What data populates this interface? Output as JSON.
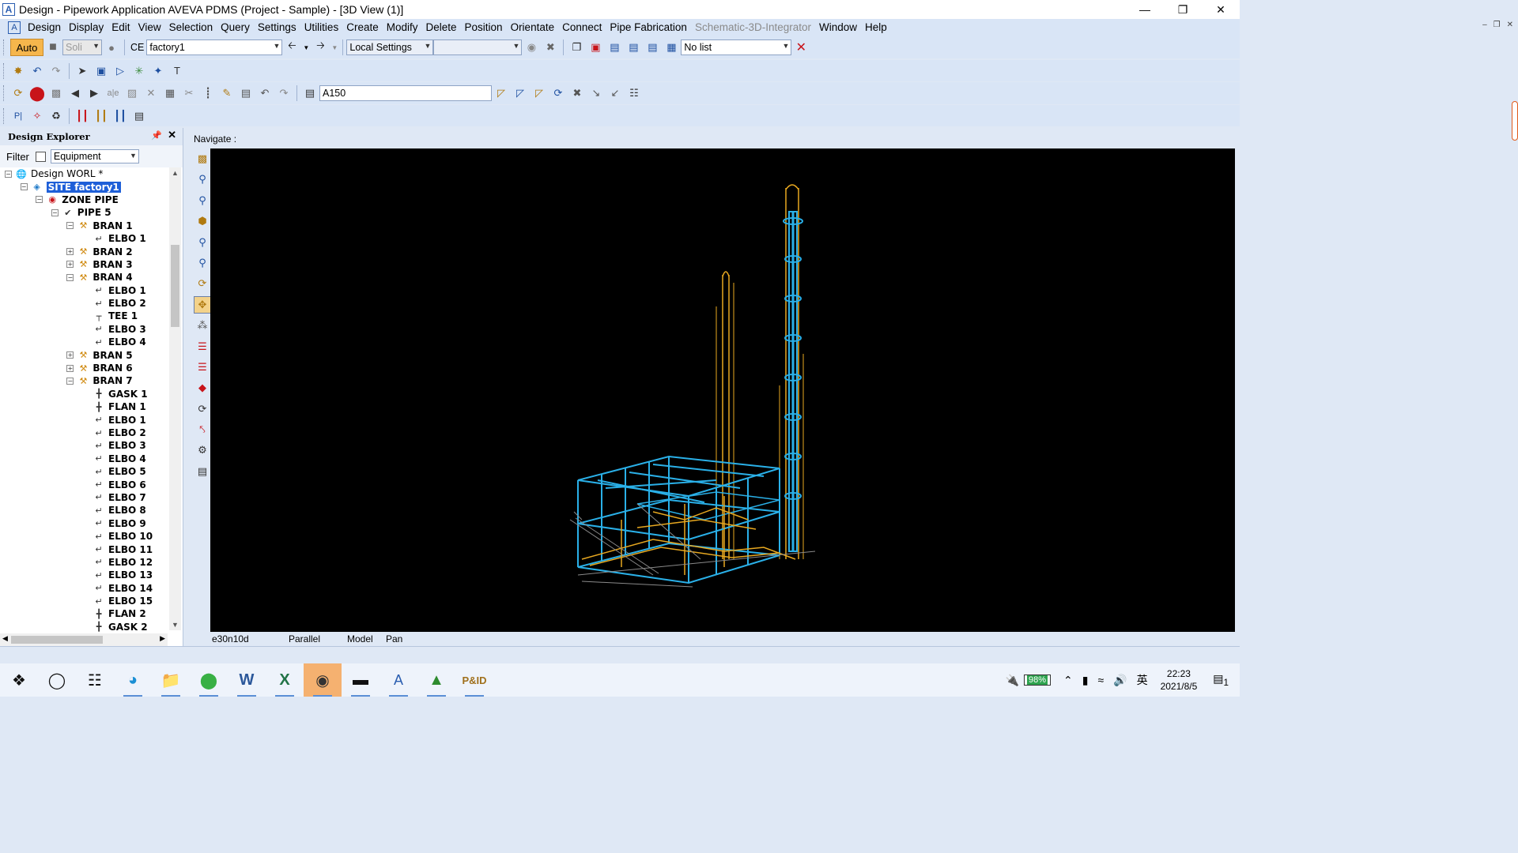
{
  "window": {
    "title": "Design - Pipework Application  AVEVA PDMS (Project - Sample) - [3D View (1)]",
    "app_icon": "A",
    "controls": [
      "minimize-icon",
      "restore-icon",
      "close-icon"
    ]
  },
  "menu": {
    "items": [
      "Design",
      "Display",
      "Edit",
      "View",
      "Selection",
      "Query",
      "Settings",
      "Utilities",
      "Create",
      "Modify",
      "Delete",
      "Position",
      "Orientate",
      "Connect",
      "Pipe Fabrication",
      "Schematic-3D-Integrator",
      "Window",
      "Help"
    ],
    "disabled": [
      "Schematic-3D-Integrator"
    ]
  },
  "toolbar1": {
    "auto_label": "Auto",
    "solid_value": "Soli",
    "ce_label": "CE",
    "ce_value": "factory1",
    "local_settings": "Local Settings",
    "blank_combo": "",
    "list_value": "No list"
  },
  "toolbar3": {
    "spec_value": "A150"
  },
  "explorer": {
    "title": "Design Explorer",
    "filter_label": "Filter",
    "filter_value": "Equipment",
    "tree": [
      {
        "label": "Design WORL *",
        "depth": 0,
        "exp": "-",
        "icon": "globe",
        "bold": false
      },
      {
        "label": "SITE factory1",
        "depth": 1,
        "exp": "-",
        "icon": "site",
        "bold": true,
        "selected": true
      },
      {
        "label": "ZONE PIPE",
        "depth": 2,
        "exp": "-",
        "icon": "zone",
        "bold": true
      },
      {
        "label": "PIPE 5",
        "depth": 3,
        "exp": "-",
        "icon": "pipe",
        "bold": true
      },
      {
        "label": "BRAN 1",
        "depth": 4,
        "exp": "-",
        "icon": "bran",
        "bold": true
      },
      {
        "label": "ELBO 1",
        "depth": 5,
        "exp": "",
        "icon": "elbo",
        "bold": true
      },
      {
        "label": "BRAN 2",
        "depth": 4,
        "exp": "+",
        "icon": "bran",
        "bold": true
      },
      {
        "label": "BRAN 3",
        "depth": 4,
        "exp": "+",
        "icon": "bran",
        "bold": true
      },
      {
        "label": "BRAN 4",
        "depth": 4,
        "exp": "-",
        "icon": "bran",
        "bold": true
      },
      {
        "label": "ELBO 1",
        "depth": 5,
        "exp": "",
        "icon": "elbo",
        "bold": true
      },
      {
        "label": "ELBO 2",
        "depth": 5,
        "exp": "",
        "icon": "elbo",
        "bold": true
      },
      {
        "label": "TEE 1",
        "depth": 5,
        "exp": "",
        "icon": "tee",
        "bold": true
      },
      {
        "label": "ELBO 3",
        "depth": 5,
        "exp": "",
        "icon": "elbo",
        "bold": true
      },
      {
        "label": "ELBO 4",
        "depth": 5,
        "exp": "",
        "icon": "elbo",
        "bold": true
      },
      {
        "label": "BRAN 5",
        "depth": 4,
        "exp": "+",
        "icon": "bran",
        "bold": true
      },
      {
        "label": "BRAN 6",
        "depth": 4,
        "exp": "+",
        "icon": "bran",
        "bold": true
      },
      {
        "label": "BRAN 7",
        "depth": 4,
        "exp": "-",
        "icon": "bran",
        "bold": true
      },
      {
        "label": "GASK 1",
        "depth": 5,
        "exp": "",
        "icon": "gask",
        "bold": true
      },
      {
        "label": "FLAN 1",
        "depth": 5,
        "exp": "",
        "icon": "flan",
        "bold": true
      },
      {
        "label": "ELBO 1",
        "depth": 5,
        "exp": "",
        "icon": "elbo",
        "bold": true
      },
      {
        "label": "ELBO 2",
        "depth": 5,
        "exp": "",
        "icon": "elbo",
        "bold": true
      },
      {
        "label": "ELBO 3",
        "depth": 5,
        "exp": "",
        "icon": "elbo",
        "bold": true
      },
      {
        "label": "ELBO 4",
        "depth": 5,
        "exp": "",
        "icon": "elbo",
        "bold": true
      },
      {
        "label": "ELBO 5",
        "depth": 5,
        "exp": "",
        "icon": "elbo",
        "bold": true
      },
      {
        "label": "ELBO 6",
        "depth": 5,
        "exp": "",
        "icon": "elbo",
        "bold": true
      },
      {
        "label": "ELBO 7",
        "depth": 5,
        "exp": "",
        "icon": "elbo",
        "bold": true
      },
      {
        "label": "ELBO 8",
        "depth": 5,
        "exp": "",
        "icon": "elbo",
        "bold": true
      },
      {
        "label": "ELBO 9",
        "depth": 5,
        "exp": "",
        "icon": "elbo",
        "bold": true
      },
      {
        "label": "ELBO 10",
        "depth": 5,
        "exp": "",
        "icon": "elbo",
        "bold": true
      },
      {
        "label": "ELBO 11",
        "depth": 5,
        "exp": "",
        "icon": "elbo",
        "bold": true
      },
      {
        "label": "ELBO 12",
        "depth": 5,
        "exp": "",
        "icon": "elbo",
        "bold": true
      },
      {
        "label": "ELBO 13",
        "depth": 5,
        "exp": "",
        "icon": "elbo",
        "bold": true
      },
      {
        "label": "ELBO 14",
        "depth": 5,
        "exp": "",
        "icon": "elbo",
        "bold": true
      },
      {
        "label": "ELBO 15",
        "depth": 5,
        "exp": "",
        "icon": "elbo",
        "bold": true
      },
      {
        "label": "FLAN 2",
        "depth": 5,
        "exp": "",
        "icon": "flan",
        "bold": true
      },
      {
        "label": "GASK 2",
        "depth": 5,
        "exp": "",
        "icon": "gask",
        "bold": true
      }
    ]
  },
  "view3d": {
    "navigate_label": "Navigate :",
    "status_direction": "e30n10d",
    "status_projection": "Parallel",
    "status_mode": "Model",
    "status_action": "Pan",
    "colors": {
      "structure": "#2ab0e8",
      "pipe": "#e8a820",
      "background": "#000000"
    }
  },
  "taskbar": {
    "apps": [
      "windows-start-icon",
      "search-circle-icon",
      "task-view-icon",
      "edge-icon",
      "file-explorer-icon",
      "app-green-icon",
      "word-icon",
      "excel-icon",
      "pdms-globe-icon",
      "terminal-icon",
      "aveva-icon",
      "app-tree-icon",
      "pid-icon"
    ],
    "battery": "98%",
    "ime": "英",
    "time": "22:23",
    "date": "2021/8/5",
    "notification_count": "1"
  }
}
